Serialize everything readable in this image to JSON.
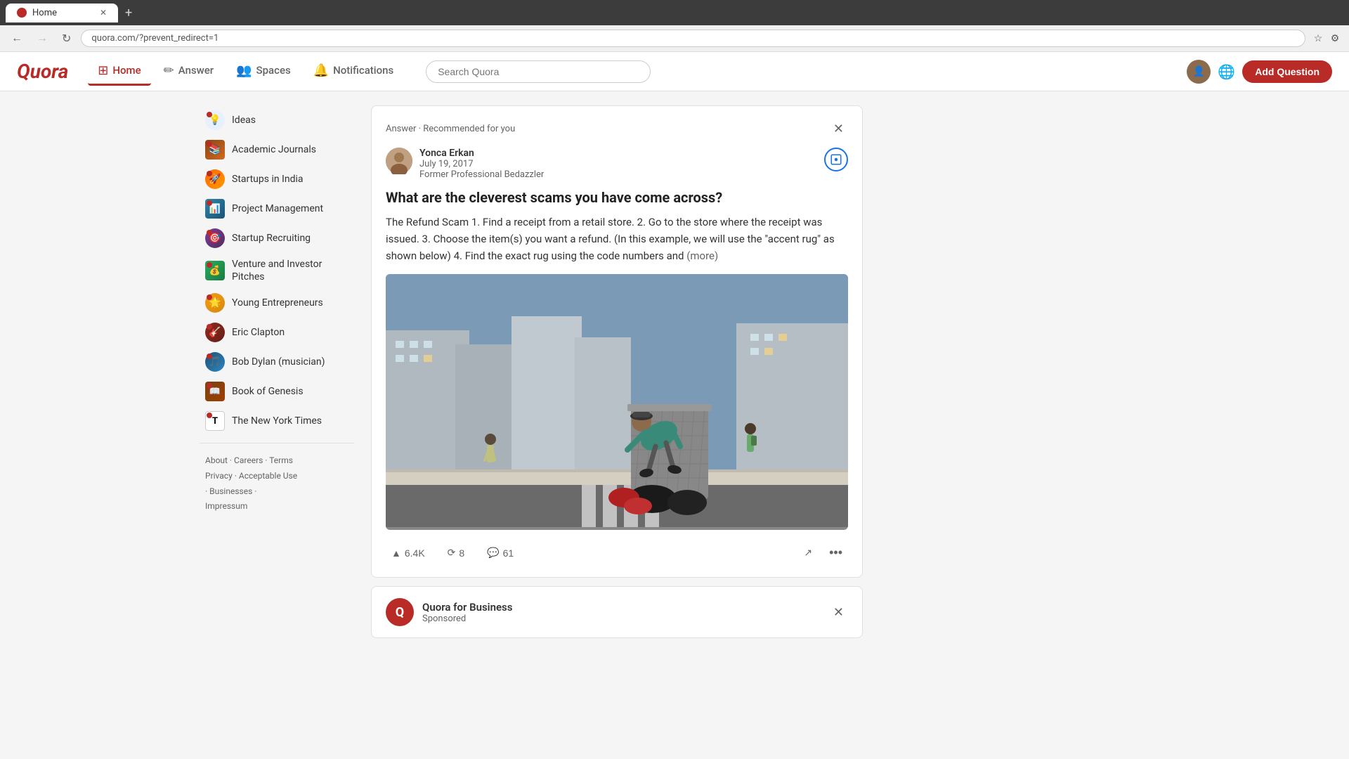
{
  "browser": {
    "tab_title": "Home",
    "url": "quora.com/?prevent_redirect=1",
    "new_tab_label": "+"
  },
  "header": {
    "logo": "Quora",
    "nav": [
      {
        "id": "home",
        "label": "Home",
        "icon": "🏠",
        "active": true
      },
      {
        "id": "answer",
        "label": "Answer",
        "icon": "✏️",
        "active": false
      },
      {
        "id": "spaces",
        "label": "Spaces",
        "icon": "👥",
        "active": false
      },
      {
        "id": "notifications",
        "label": "Notifications",
        "icon": "🔔",
        "active": false
      }
    ],
    "search_placeholder": "Search Quora",
    "add_question_label": "Add Question"
  },
  "sidebar": {
    "items": [
      {
        "id": "ideas",
        "label": "Ideas",
        "icon": "💡"
      },
      {
        "id": "academic-journals",
        "label": "Academic Journals",
        "icon": "📚"
      },
      {
        "id": "startups-india",
        "label": "Startups in India",
        "icon": "🚀"
      },
      {
        "id": "project-management",
        "label": "Project Management",
        "icon": "📊"
      },
      {
        "id": "startup-recruiting",
        "label": "Startup Recruiting",
        "icon": "🎯"
      },
      {
        "id": "venture-investor",
        "label": "Venture and Investor Pitches",
        "icon": "💰"
      },
      {
        "id": "young-entrepreneurs",
        "label": "Young Entrepreneurs",
        "icon": "🌟"
      },
      {
        "id": "eric-clapton",
        "label": "Eric Clapton",
        "icon": "🎸"
      },
      {
        "id": "bob-dylan",
        "label": "Bob Dylan (musician)",
        "icon": "🎵"
      },
      {
        "id": "book-of-genesis",
        "label": "Book of Genesis",
        "icon": "📖"
      },
      {
        "id": "new-york-times",
        "label": "The New York Times",
        "icon": "📰"
      }
    ],
    "footer": {
      "links": [
        "About",
        "Careers",
        "Terms",
        "Privacy",
        "Acceptable Use",
        "Businesses",
        "Impressum"
      ]
    }
  },
  "main": {
    "card": {
      "label": "Answer · Recommended for you",
      "author": {
        "name": "Yonca Erkan",
        "date": "July 19, 2017",
        "title": "Former Professional Bedazzler"
      },
      "question": "What are the cleverest scams you have come across?",
      "answer_text": "The Refund Scam 1. Find a receipt from a retail store. 2. Go to the store where the receipt was issued. 3. Choose the item(s) you want a refund. (In this example, we will use the \"accent rug\" as shown below) 4. Find the exact rug using the code numbers and",
      "more_label": "(more)",
      "actions": {
        "upvote": "6.4K",
        "reshare": "8",
        "comment": "61"
      }
    },
    "business_card": {
      "name": "Quora for Business",
      "sponsored": "Sponsored",
      "logo_letter": "Q"
    }
  }
}
